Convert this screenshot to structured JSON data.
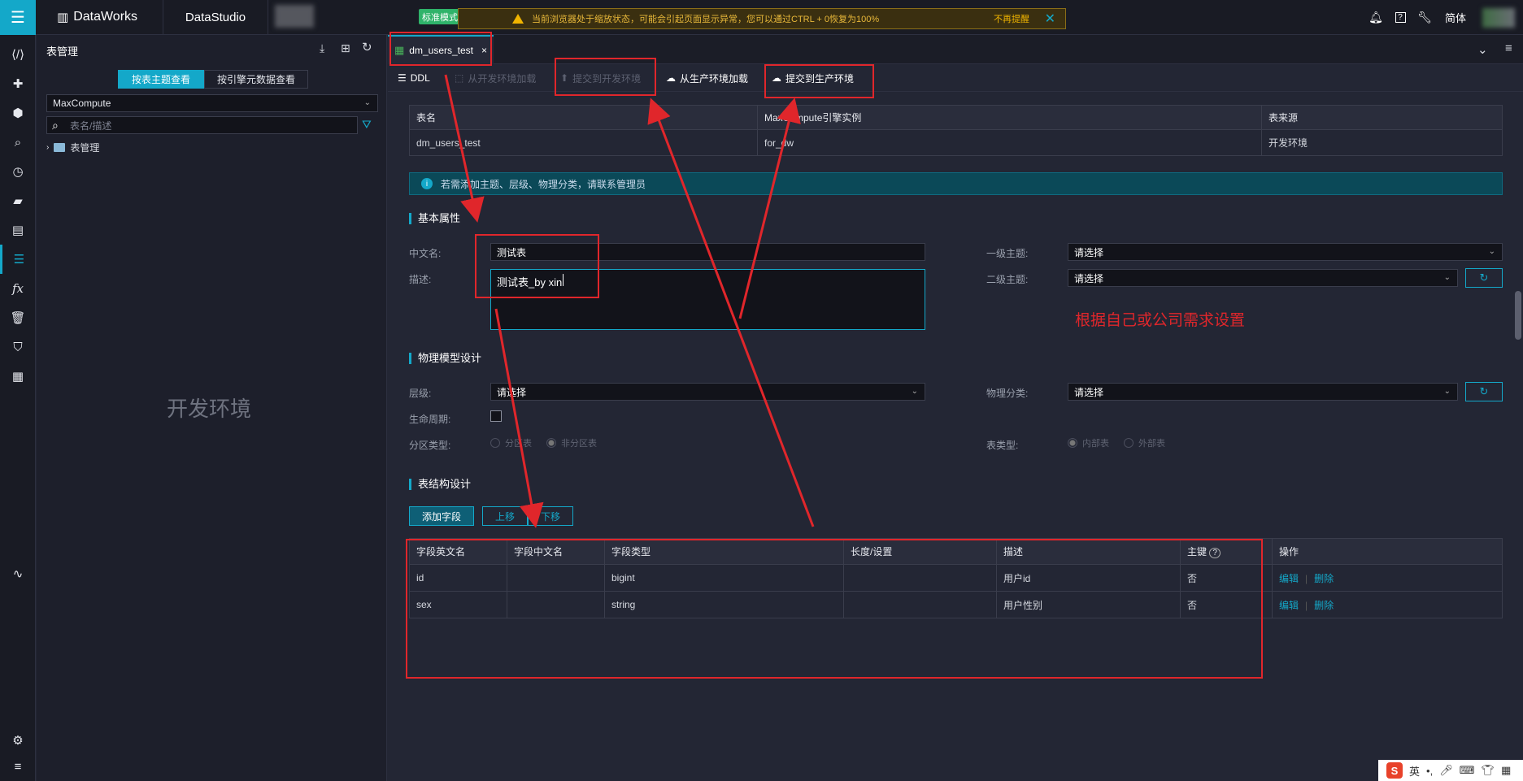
{
  "topbar": {
    "brand": "DataWorks",
    "studio": "DataStudio",
    "edition_badge": "标准模式",
    "warning": "当前浏览器处于缩放状态，可能会引起页面显示异常，您可以通过CTRL + 0恢复为100%",
    "warning_dismiss": "不再提醒",
    "lang": "简体",
    "help_icon": "?"
  },
  "left_panel": {
    "title": "表管理",
    "seg_by_topic": "按表主题查看",
    "seg_by_engine": "按引擎元数据查看",
    "engine_select": "MaxCompute",
    "search_placeholder": "表名/描述",
    "tree_root": "表管理",
    "watermark": "开发环境"
  },
  "tab": {
    "label": "dm_users_test",
    "close": "×"
  },
  "toolbar": {
    "ddl": "DDL",
    "load_dev": "从开发环境加载",
    "submit_dev": "提交到开发环境",
    "load_prod": "从生产环境加载",
    "submit_prod": "提交到生产环境"
  },
  "meta_table": {
    "headers": [
      "表名",
      "MaxCompute引擎实例",
      "表来源"
    ],
    "row": [
      "dm_users_test",
      "for_dw",
      "开发环境"
    ]
  },
  "info_text": "若需添加主题、层级、物理分类，请联系管理员",
  "basic": {
    "section": "基本属性",
    "cn_name_label": "中文名:",
    "cn_name_value": "测试表",
    "desc_label": "描述:",
    "desc_value": "测试表_by xin",
    "topic1_label": "一级主题:",
    "topic1_value": "请选择",
    "topic2_label": "二级主题:",
    "topic2_value": "请选择"
  },
  "physical": {
    "section": "物理模型设计",
    "layer_label": "层级:",
    "layer_value": "请选择",
    "category_label": "物理分类:",
    "category_value": "请选择",
    "lifecycle_label": "生命周期:",
    "partition_label": "分区类型:",
    "partition_opts": [
      "分区表",
      "非分区表"
    ],
    "tabletype_label": "表类型:",
    "tabletype_opts": [
      "内部表",
      "外部表"
    ]
  },
  "structure": {
    "section": "表结构设计",
    "add_field": "添加字段",
    "move_up": "上移",
    "move_down": "下移",
    "headers": [
      "字段英文名",
      "字段中文名",
      "字段类型",
      "长度/设置",
      "描述",
      "主键",
      "操作"
    ],
    "rows": [
      {
        "en": "id",
        "cn": "",
        "type": "bigint",
        "len": "",
        "desc": "用户id",
        "pk": "否"
      },
      {
        "en": "sex",
        "cn": "",
        "type": "string",
        "len": "",
        "desc": "用户性别",
        "pk": "否"
      }
    ],
    "edit": "编辑",
    "delete": "删除"
  },
  "annotation_note": "根据自己或公司需求设置",
  "ime": {
    "lang": "英"
  }
}
